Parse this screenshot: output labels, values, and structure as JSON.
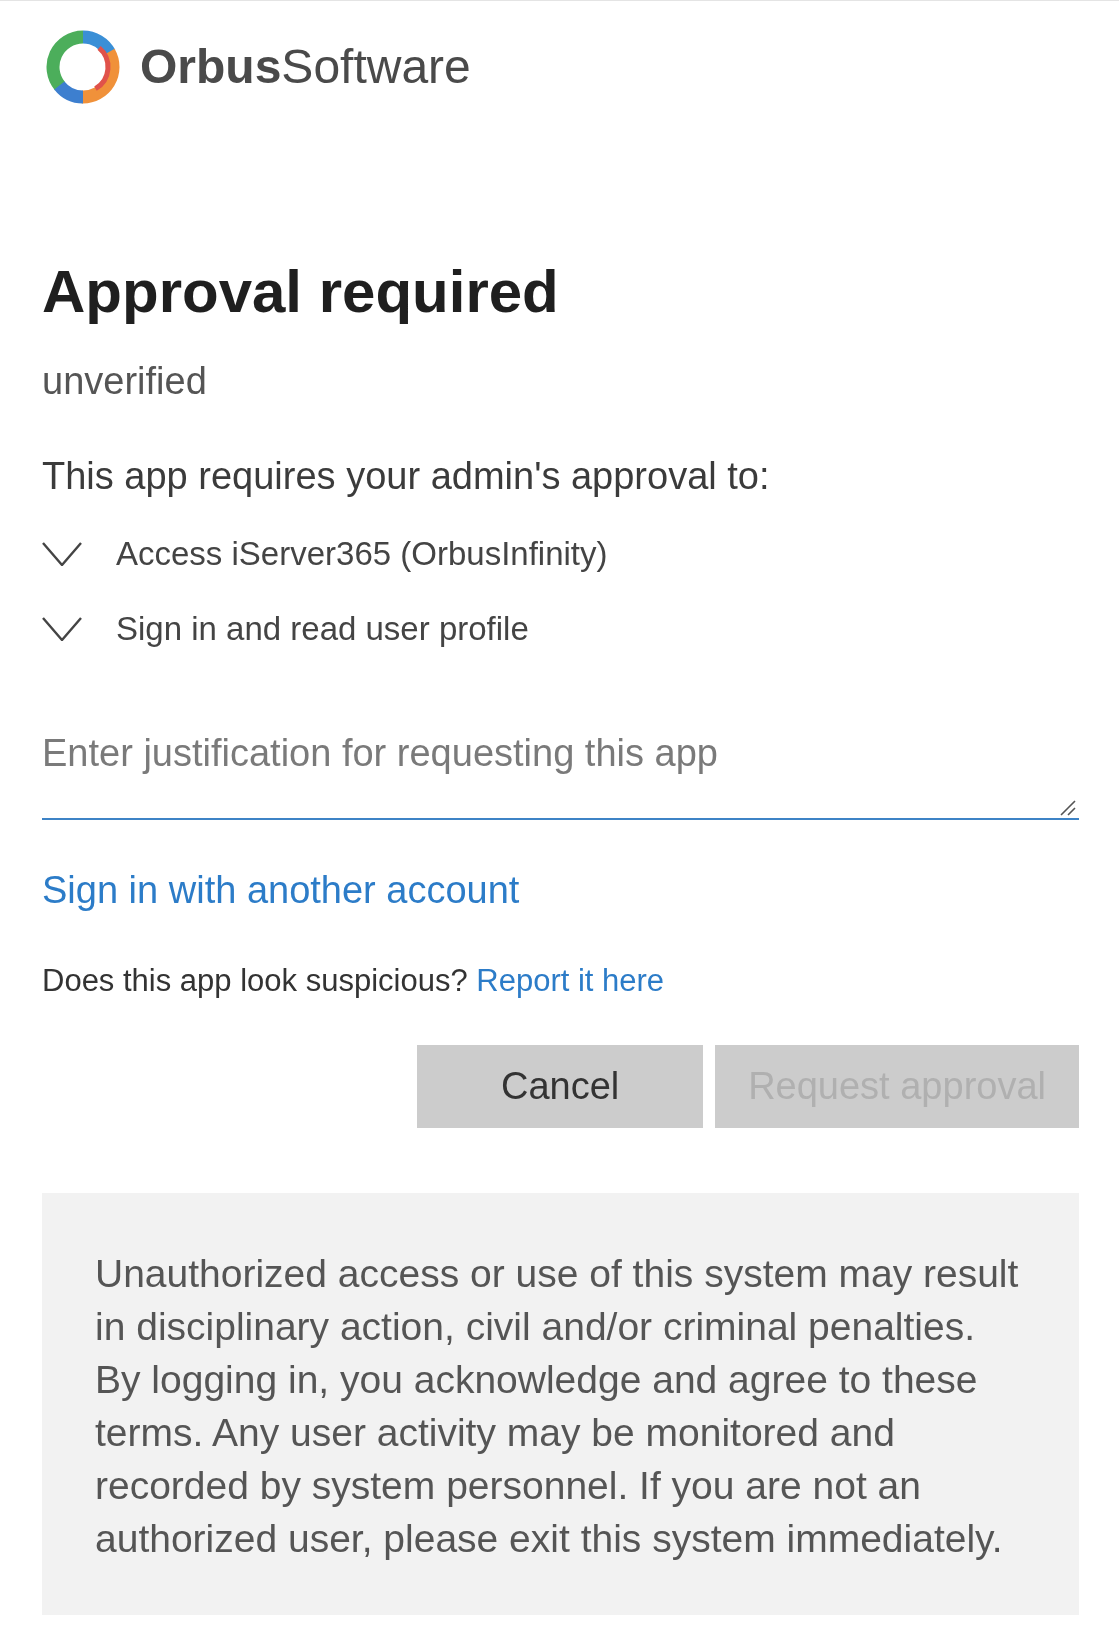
{
  "logo": {
    "wordmark": "**Orbus**Software"
  },
  "heading": "Approval required",
  "subtitle": "unverified",
  "intro": "This app requires your admin's approval to:",
  "permissions": [
    {
      "label": "Access iServer365 (OrbusInfinity)",
      "expanded": false
    },
    {
      "label": "Sign in and read user profile",
      "expanded": false
    }
  ],
  "justification": {
    "placeholder": "Enter justification for requesting this app"
  },
  "switch_account_link": "Sign in with another account",
  "report": {
    "question": "Does this app look suspicious?",
    "link": "Report it here"
  },
  "buttons": [
    {
      "label": "Cancel",
      "disabled": false
    },
    {
      "label": "Request approval",
      "disabled": true
    }
  ],
  "notice": "Unauthorized access or use of this system may result in disciplinary action, civil and/or criminal penalties. By logging in, you acknowledge and agree to these terms. Any user activity may be monitored and recorded by system personnel. If you are not an authorized user, please exit this system immediately."
}
